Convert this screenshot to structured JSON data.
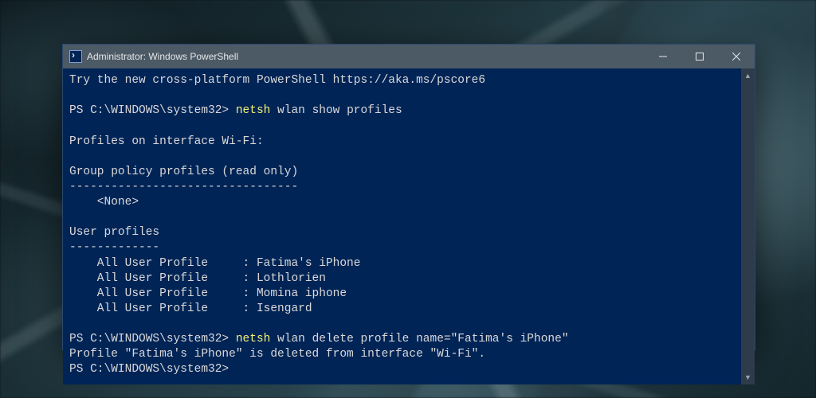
{
  "titlebar": {
    "title": "Administrator: Windows PowerShell"
  },
  "terminal": {
    "banner": "Try the new cross-platform PowerShell https://aka.ms/pscore6",
    "prompt1_prefix": "PS C:\\WINDOWS\\system32> ",
    "cmd1_first_word": "netsh",
    "cmd1_rest": " wlan show profiles",
    "section_interface": "Profiles on interface Wi-Fi:",
    "gp_header": "Group policy profiles (read only)",
    "gp_sep": "---------------------------------",
    "gp_none": "    <None>",
    "up_header": "User profiles",
    "up_sep": "-------------",
    "profiles": [
      "    All User Profile     : Fatima's iPhone",
      "    All User Profile     : Lothlorien",
      "    All User Profile     : Momina iphone",
      "    All User Profile     : Isengard"
    ],
    "prompt2_prefix": "PS C:\\WINDOWS\\system32> ",
    "cmd2_first_word": "netsh",
    "cmd2_rest": " wlan delete profile name=\"Fatima's iPhone\"",
    "delete_result": "Profile \"Fatima's iPhone\" is deleted from interface \"Wi-Fi\".",
    "prompt3": "PS C:\\WINDOWS\\system32>"
  }
}
